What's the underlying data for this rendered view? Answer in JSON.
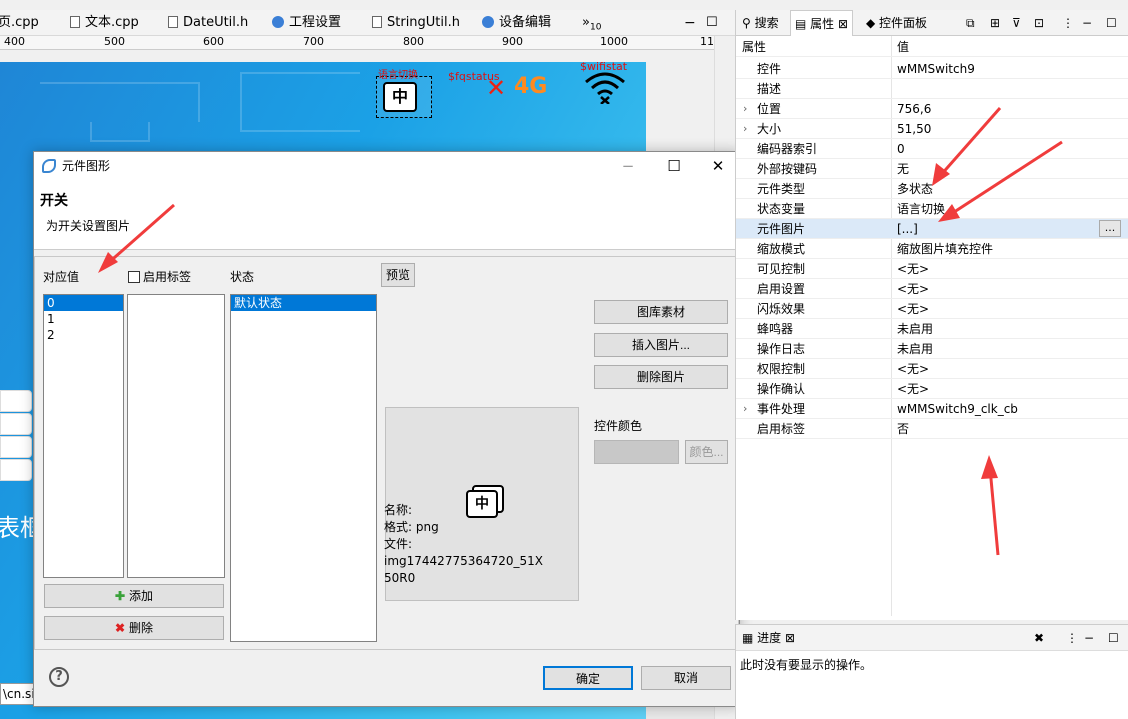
{
  "editor_tabs": [
    {
      "label": "页.cpp"
    },
    {
      "label": "文本.cpp"
    },
    {
      "label": "DateUtil.h"
    },
    {
      "label": "工程设置"
    },
    {
      "label": "StringUtil.h"
    },
    {
      "label": "设备编辑"
    },
    {
      "label": "»",
      "count": "10"
    }
  ],
  "ruler": [
    "400",
    "500",
    "600",
    "700",
    "800",
    "900",
    "1000",
    "11"
  ],
  "canvas": {
    "lang_label": "语言切换",
    "fq_label": "$fqstatus",
    "wifi_label": "$wifistat",
    "lang_icon": "中",
    "net_4g": "4G",
    "biao": "表框",
    "cnsi": "\\cn.sir"
  },
  "dialog": {
    "title": "元件图形",
    "header_title": "开关",
    "header_subtitle": "为开关设置图片",
    "value_label": "对应值",
    "enable_tag_label": "启用标签",
    "state_label": "状态",
    "preview_button": "预览",
    "values": [
      "0",
      "1",
      "2"
    ],
    "states": [
      "默认状态"
    ],
    "preview_icon": "中",
    "gallery_button": "图库素材",
    "insert_button": "插入图片...",
    "delete_image_button": "删除图片",
    "color_label": "控件颜色",
    "color_button": "颜色...",
    "info": {
      "name_label": "名称:",
      "format_label": "格式:",
      "format_value": "png",
      "file_label": "文件:",
      "file_line1": "img17442775364720_51X",
      "file_line2": "50R0"
    },
    "add_button": "添加",
    "delete_button": "删除",
    "ok_button": "确定",
    "cancel_button": "取消",
    "help": "?"
  },
  "right_panel": {
    "tabs": [
      "搜索",
      "属性",
      "控件面板"
    ],
    "header_key": "属性",
    "header_value": "值",
    "rows": [
      {
        "key": "控件",
        "value": "wMMSwitch9"
      },
      {
        "key": "描述",
        "value": ""
      },
      {
        "key": "位置",
        "value": "756,6"
      },
      {
        "key": "大小",
        "value": "51,50"
      },
      {
        "key": "编码器索引",
        "value": "0"
      },
      {
        "key": "外部按键码",
        "value": "无"
      },
      {
        "key": "元件类型",
        "value": "多状态"
      },
      {
        "key": "状态变量",
        "value": "语言切换"
      },
      {
        "key": "元件图片",
        "value": "[...]"
      },
      {
        "key": "缩放模式",
        "value": "缩放图片填充控件"
      },
      {
        "key": "可见控制",
        "value": "<无>"
      },
      {
        "key": "启用设置",
        "value": "<无>"
      },
      {
        "key": "闪烁效果",
        "value": "<无>"
      },
      {
        "key": "蜂鸣器",
        "value": "未启用"
      },
      {
        "key": "操作日志",
        "value": "未启用"
      },
      {
        "key": "权限控制",
        "value": "<无>"
      },
      {
        "key": "操作确认",
        "value": "<无>"
      },
      {
        "key": "事件处理",
        "value": "wMMSwitch9_clk_cb"
      },
      {
        "key": "启用标签",
        "value": "否"
      }
    ],
    "ellipsis": "..."
  },
  "progress_panel": {
    "title": "进度",
    "message": "此时没有要显示的操作。"
  },
  "colors": {
    "accent": "#0078d7",
    "arrow": "#f03c3c"
  }
}
